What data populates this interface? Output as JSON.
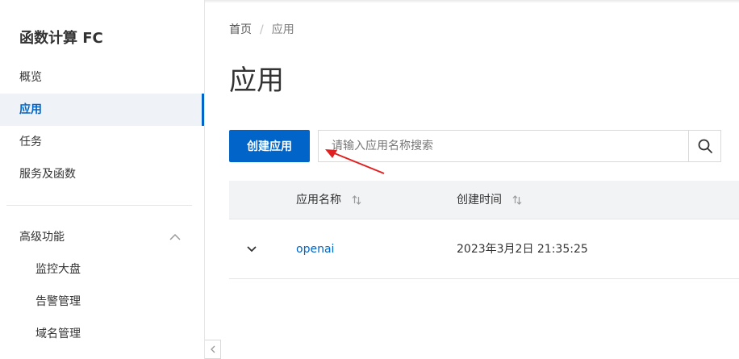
{
  "sidebar": {
    "product_title": "函数计算 FC",
    "items": [
      {
        "label": "概览"
      },
      {
        "label": "应用"
      },
      {
        "label": "任务"
      },
      {
        "label": "服务及函数"
      }
    ],
    "advanced": {
      "label": "高级功能",
      "items": [
        {
          "label": "监控大盘"
        },
        {
          "label": "告警管理"
        },
        {
          "label": "域名管理"
        }
      ]
    }
  },
  "breadcrumb": {
    "home": "首页",
    "separator": "/",
    "current": "应用"
  },
  "main": {
    "title": "应用",
    "create_label": "创建应用",
    "search_placeholder": "请输入应用名称搜索"
  },
  "table": {
    "columns": [
      "应用名称",
      "创建时间"
    ],
    "rows": [
      {
        "name": "openai",
        "created": "2023年3月2日 21:35:25"
      }
    ]
  },
  "colors": {
    "brand": "#0064c8",
    "accent": "#ff6a00",
    "annotation": "#e02020"
  }
}
